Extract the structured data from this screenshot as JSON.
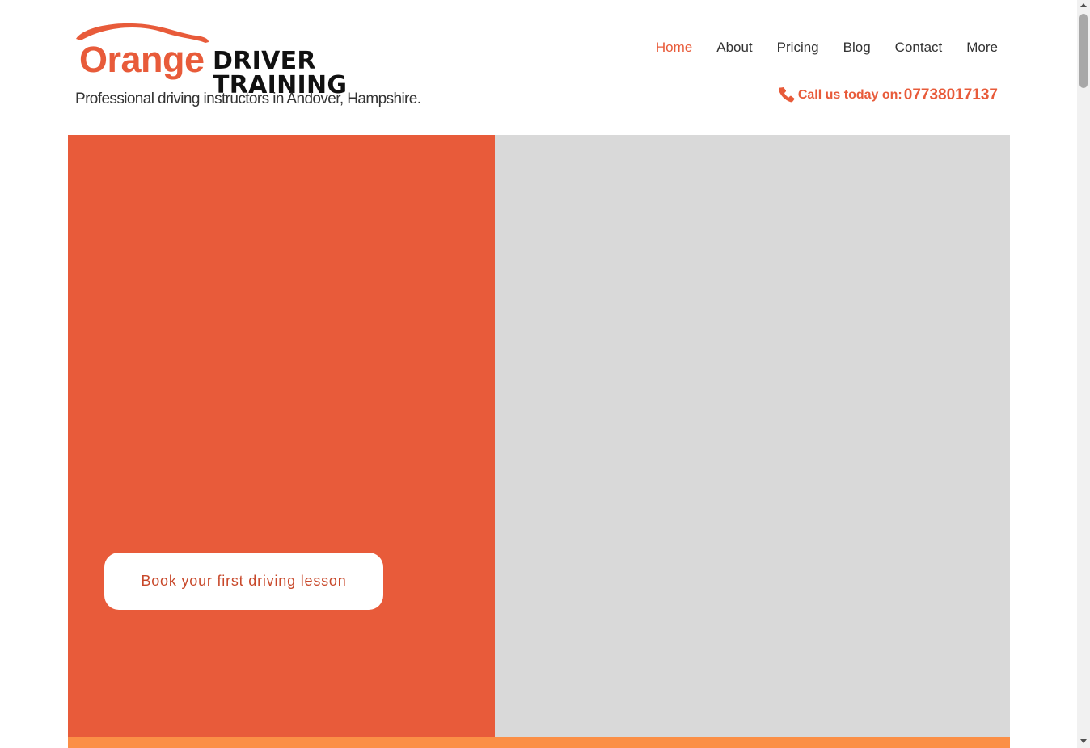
{
  "brand": {
    "logo_word": "Orange",
    "logo_rest": "DRIVER TRAINING",
    "tagline": "Professional driving instructors in Andover, Hampshire."
  },
  "nav": {
    "items": [
      {
        "label": "Home",
        "active": true
      },
      {
        "label": "About",
        "active": false
      },
      {
        "label": "Pricing",
        "active": false
      },
      {
        "label": "Blog",
        "active": false
      },
      {
        "label": "Contact",
        "active": false
      },
      {
        "label": "More",
        "active": false
      }
    ]
  },
  "contact": {
    "label": "Call us today on:",
    "phone": "07738017137",
    "icon": "phone-icon"
  },
  "hero": {
    "cta_label": "Book your first driving lesson"
  },
  "colors": {
    "accent": "#e85b3a",
    "hero_left": "#e85b3a",
    "hero_right": "#d9d9d9",
    "strip": "#fb8f46",
    "cta_text": "#c8482a"
  }
}
